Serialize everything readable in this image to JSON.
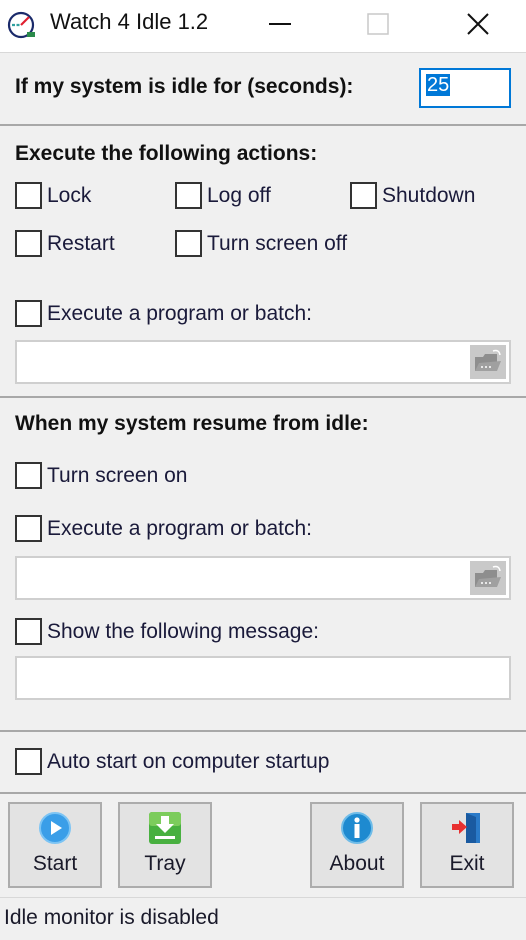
{
  "window": {
    "title": "Watch 4 Idle 1.2",
    "controls": {
      "minimize": "minimize",
      "maximize": "maximize",
      "close": "close"
    }
  },
  "idle": {
    "label": "If my system is idle for (seconds):",
    "value": "25"
  },
  "actions": {
    "heading": "Execute the following actions:",
    "checkboxes": [
      {
        "label": "Lock",
        "checked": false
      },
      {
        "label": "Log off",
        "checked": false
      },
      {
        "label": "Shutdown",
        "checked": false
      },
      {
        "label": "Restart",
        "checked": false
      },
      {
        "label": "Turn screen off",
        "checked": false
      }
    ],
    "execute": {
      "label": "Execute a program or batch:",
      "checked": false,
      "value": ""
    }
  },
  "resume": {
    "heading": "When my system resume from idle:",
    "turn_screen_on": {
      "label": "Turn screen on",
      "checked": false
    },
    "execute": {
      "label": "Execute a program or batch:",
      "checked": false,
      "value": ""
    },
    "message": {
      "label": "Show the following message:",
      "checked": false,
      "value": ""
    }
  },
  "autostart": {
    "label": "Auto start on computer startup",
    "checked": false
  },
  "toolbar": {
    "start": {
      "label": "Start",
      "icon": "play-icon"
    },
    "tray": {
      "label": "Tray",
      "icon": "download-icon"
    },
    "about": {
      "label": "About",
      "icon": "info-icon"
    },
    "exit": {
      "label": "Exit",
      "icon": "exit-door-icon"
    }
  },
  "status": {
    "text": "Idle monitor is disabled"
  },
  "colors": {
    "accent": "#0078d7",
    "background": "#f0f0f0"
  }
}
